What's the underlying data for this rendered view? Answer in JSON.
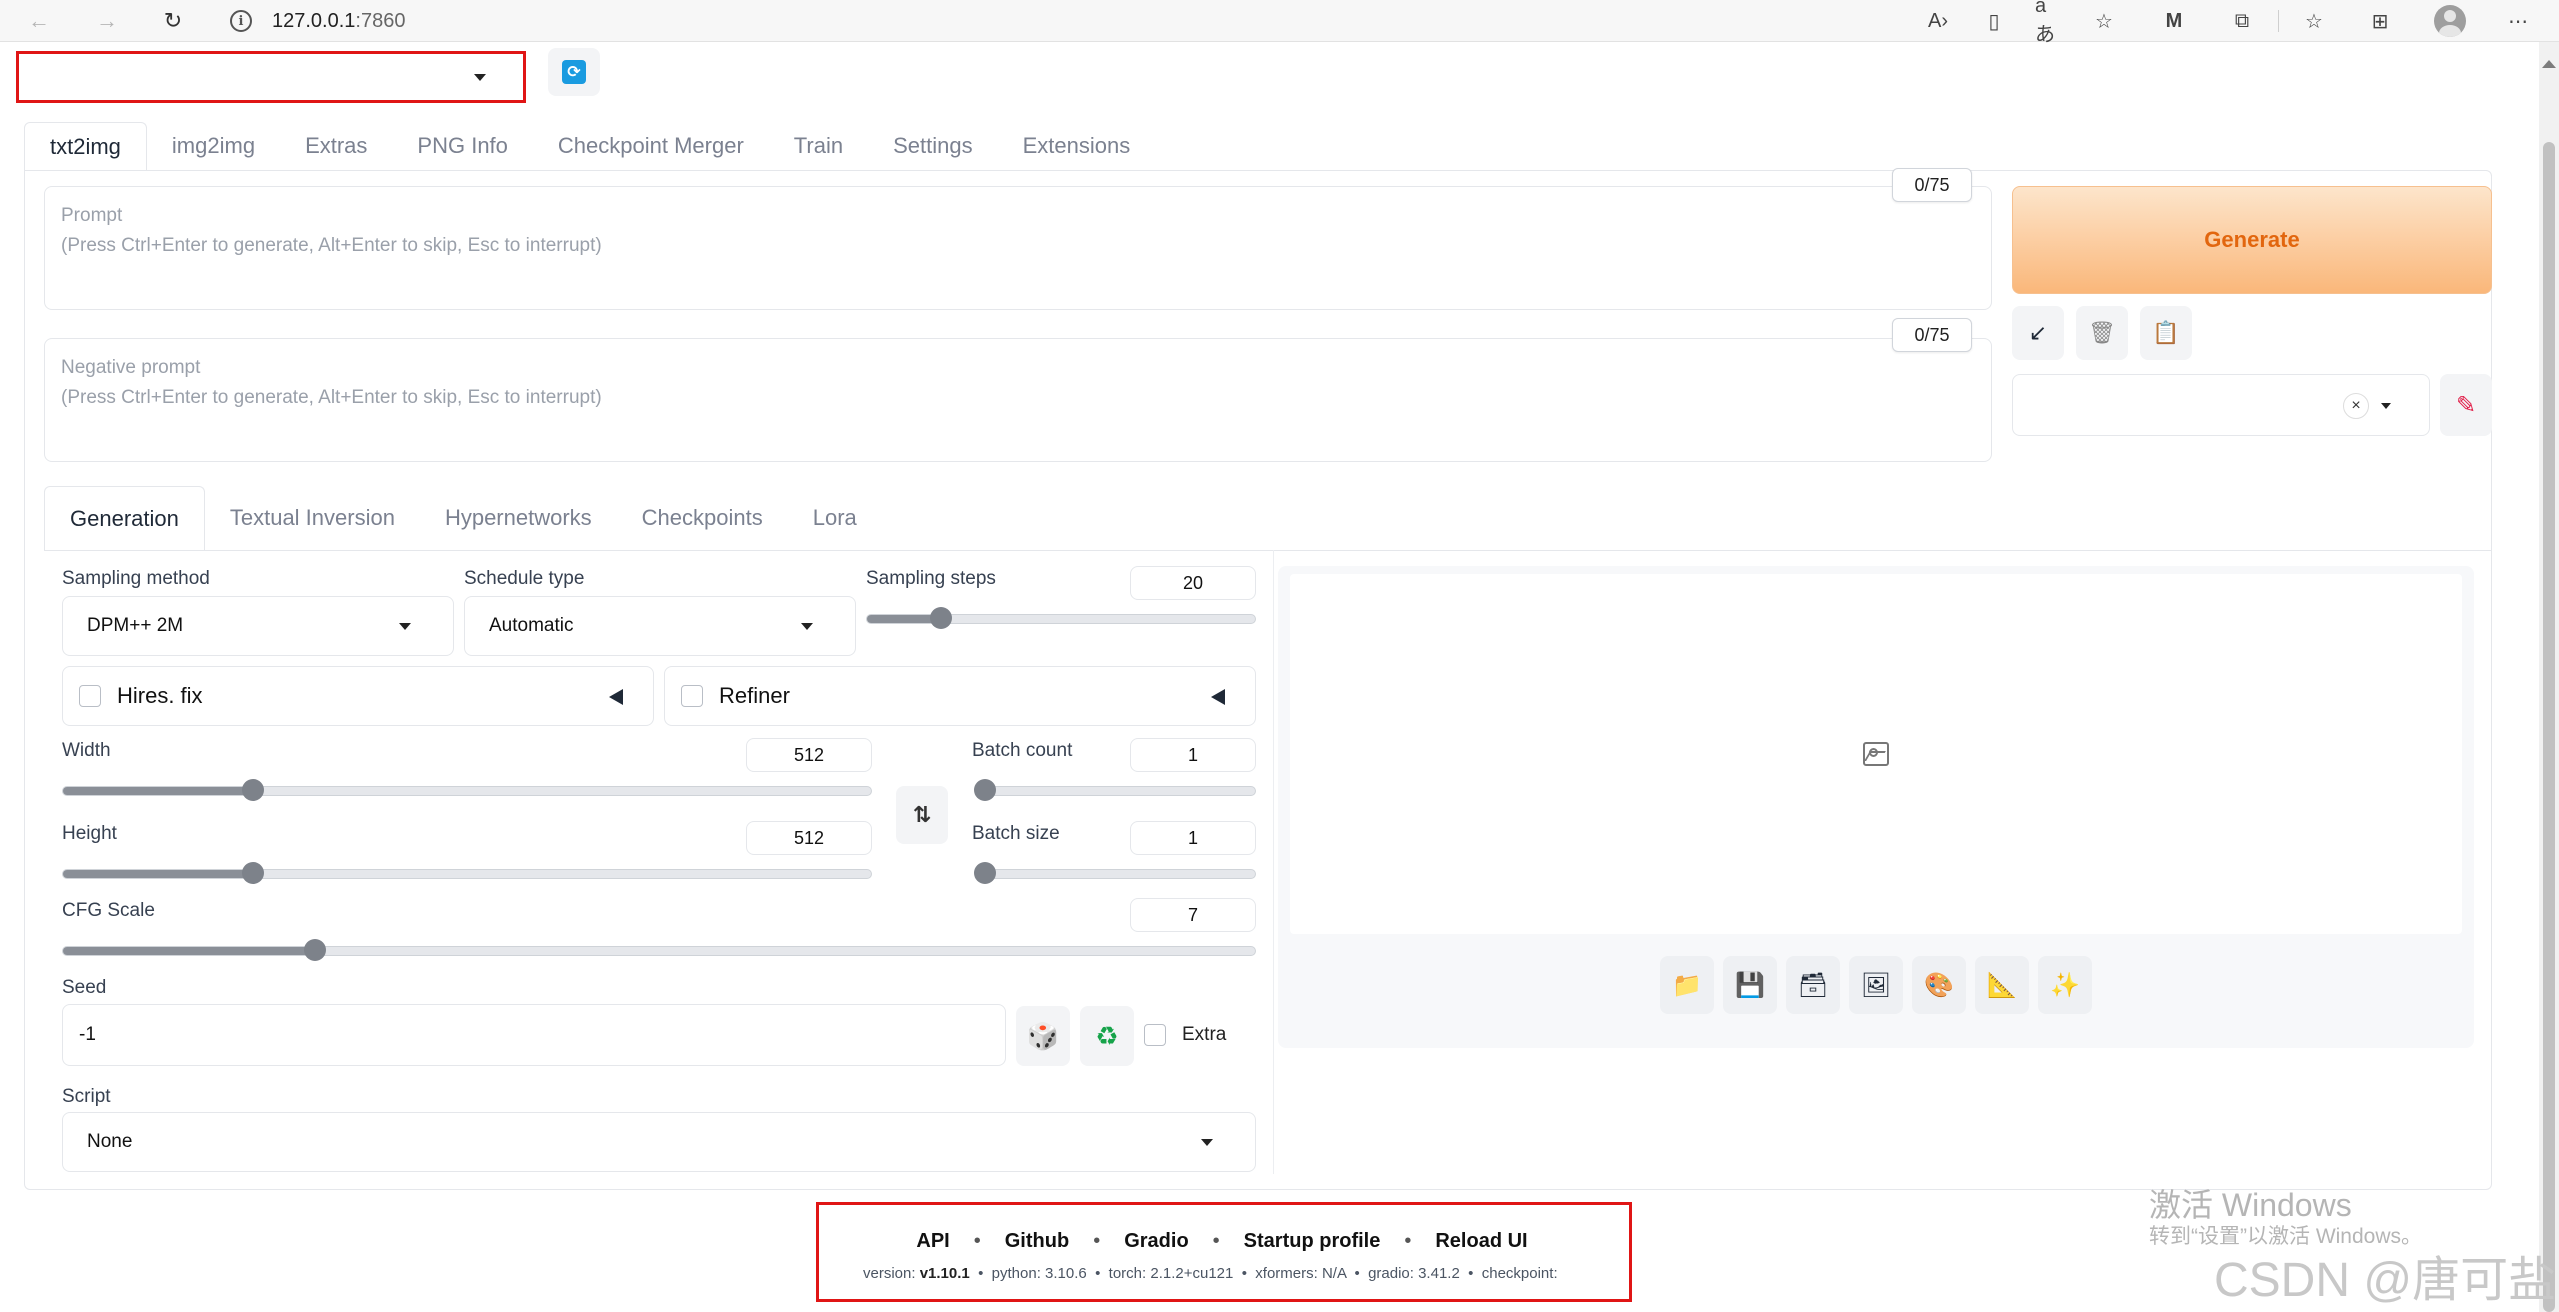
{
  "browser": {
    "url_host": "127.0.0.1",
    "url_port": ":7860",
    "icons": [
      "back-icon",
      "forward-icon",
      "refresh-icon",
      "info-icon",
      "read-aloud-icon",
      "immersive-reader-icon",
      "translate-icon",
      "add-favorite-icon",
      "extension-m-icon",
      "extensions-icon",
      "favorites-icon",
      "collections-icon",
      "profile-icon",
      "more-icon"
    ]
  },
  "checkpoint": {
    "value": "",
    "refresh_icon": "refresh-icon"
  },
  "main_tabs": [
    "txt2img",
    "img2img",
    "Extras",
    "PNG Info",
    "Checkpoint Merger",
    "Train",
    "Settings",
    "Extensions"
  ],
  "prompt": {
    "label": "Prompt",
    "hint": "(Press Ctrl+Enter to generate, Alt+Enter to skip, Esc to interrupt)",
    "token_count": "0/75"
  },
  "negative_prompt": {
    "label": "Negative prompt",
    "hint": "(Press Ctrl+Enter to generate, Alt+Enter to skip, Esc to interrupt)",
    "token_count": "0/75"
  },
  "generate": {
    "label": "Generate",
    "color": "#e2660e"
  },
  "tool_buttons": [
    "arrow-down-left-icon",
    "trash-icon",
    "clipboard-icon"
  ],
  "styles": {
    "clear": "×",
    "edit_icon": "pencil-icon"
  },
  "sub_tabs": [
    "Generation",
    "Textual Inversion",
    "Hypernetworks",
    "Checkpoints",
    "Lora"
  ],
  "generation": {
    "sampling_method": {
      "label": "Sampling method",
      "value": "DPM++ 2M"
    },
    "schedule_type": {
      "label": "Schedule type",
      "value": "Automatic"
    },
    "sampling_steps": {
      "label": "Sampling steps",
      "value": "20",
      "fraction": 0.19
    },
    "hires_fix": {
      "label": "Hires. fix"
    },
    "refiner": {
      "label": "Refiner"
    },
    "width": {
      "label": "Width",
      "value": "512",
      "fraction": 0.235
    },
    "height": {
      "label": "Height",
      "value": "512",
      "fraction": 0.235
    },
    "batch_count": {
      "label": "Batch count",
      "value": "1",
      "fraction": 0.0
    },
    "batch_size": {
      "label": "Batch size",
      "value": "1",
      "fraction": 0.0
    },
    "cfg_scale": {
      "label": "CFG Scale",
      "value": "7",
      "fraction": 0.211
    },
    "seed": {
      "label": "Seed",
      "value": "-1",
      "extra_label": "Extra"
    },
    "script": {
      "label": "Script",
      "value": "None"
    },
    "swap_icon": "⇅"
  },
  "gallery": {
    "buttons": [
      "folder-icon",
      "save-icon",
      "zip-icon",
      "send-to-img2img-icon",
      "send-to-inpaint-icon",
      "send-to-extras-icon",
      "sparkles-icon"
    ]
  },
  "footer": {
    "links": [
      "API",
      "Github",
      "Gradio",
      "Startup profile",
      "Reload UI"
    ],
    "version_label": "version:",
    "version": "v1.10.1",
    "python": "python: 3.10.6",
    "torch": "torch: 2.1.2+cu121",
    "xformers": "xformers: N/A",
    "gradio": "gradio: 3.41.2",
    "checkpoint": "checkpoint:"
  },
  "watermark": {
    "line1": "激活 Windows",
    "line2": "转到“设置”以激活 Windows。",
    "csdn": "CSDN @唐可盐"
  },
  "colors": {
    "highlight_box": "#e01515",
    "generate_gradient_start": "#fde5cb",
    "generate_gradient_end": "#fab77a"
  }
}
